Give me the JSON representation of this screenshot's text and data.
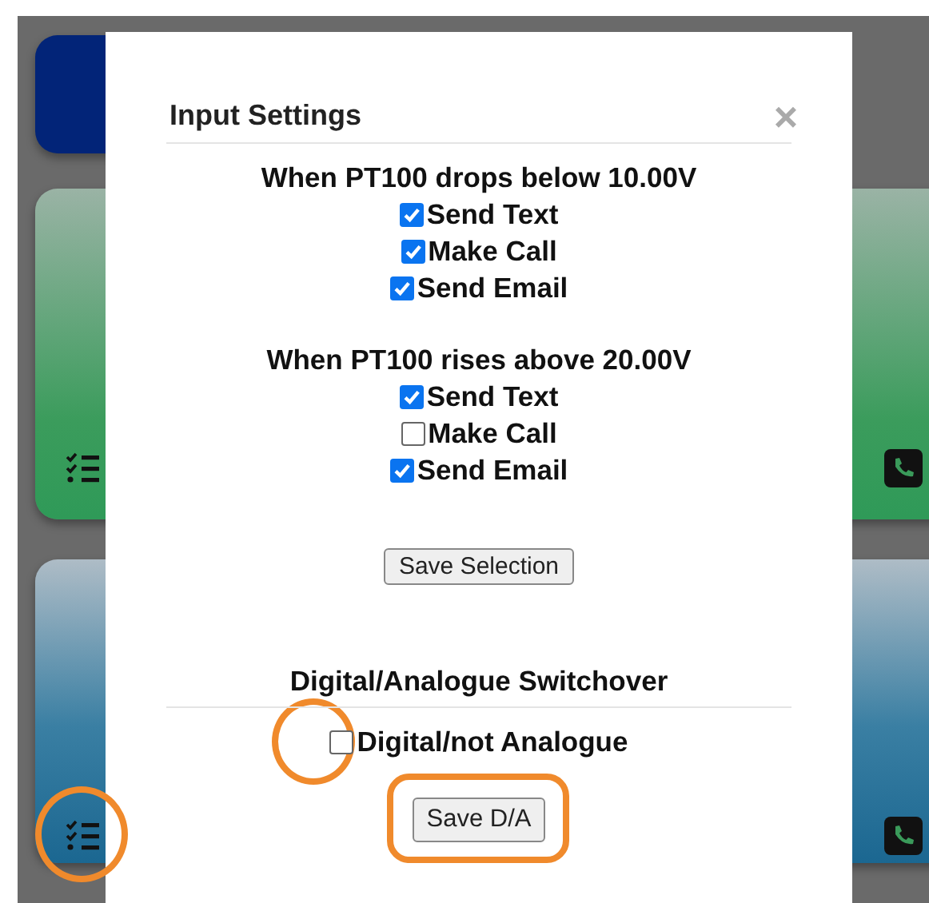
{
  "dialog": {
    "title": "Input Settings",
    "close": "×",
    "rules": [
      {
        "heading": "When PT100 drops below 10.00V",
        "options": [
          {
            "label": "Send Text",
            "checked": true
          },
          {
            "label": "Make Call",
            "checked": true
          },
          {
            "label": "Send Email",
            "checked": true
          }
        ]
      },
      {
        "heading": "When PT100 rises above 20.00V",
        "options": [
          {
            "label": "Send Text",
            "checked": true
          },
          {
            "label": "Make Call",
            "checked": false
          },
          {
            "label": "Send Email",
            "checked": true
          }
        ]
      }
    ],
    "save_button": "Save Selection",
    "switchover": {
      "heading": "Digital/Analogue Switchover",
      "option": {
        "label": "Digital/not Analogue",
        "checked": false
      },
      "save_button": "Save D/A"
    }
  }
}
